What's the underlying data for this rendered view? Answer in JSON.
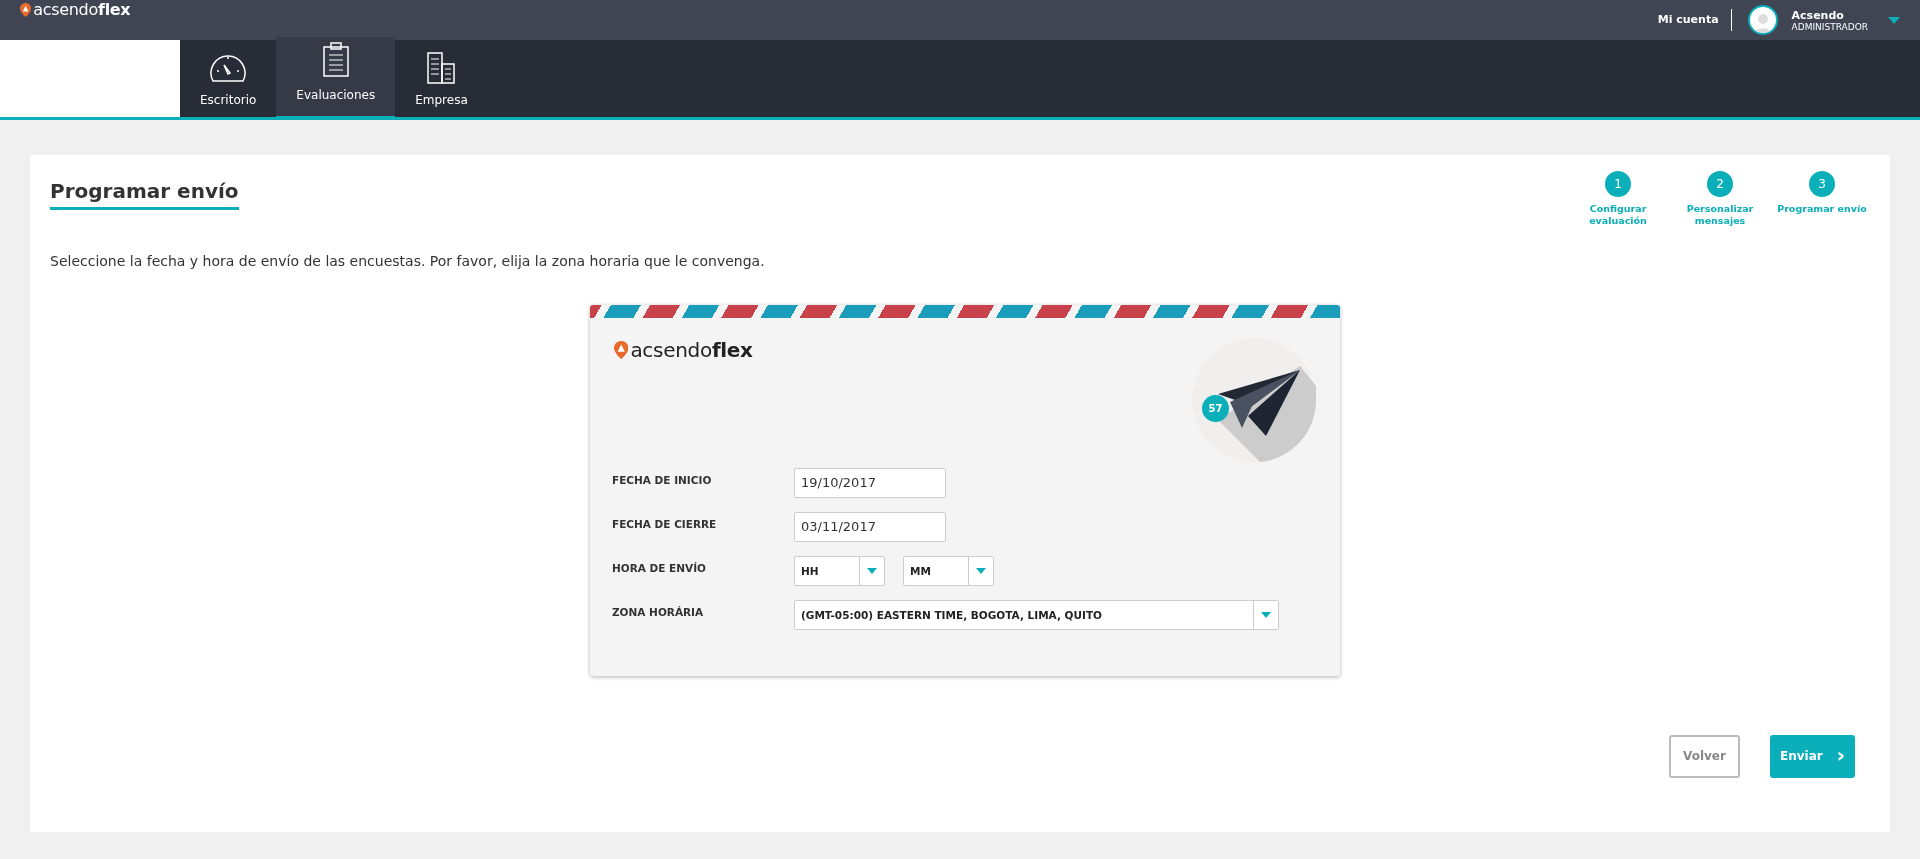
{
  "header": {
    "logo": "acsendo**flex**",
    "account_link": "Mi cuenta",
    "user": {
      "name": "Acsendo",
      "role": "ADMINISTRADOR"
    }
  },
  "nav_tabs": [
    {
      "label": "Escritorio",
      "kind": "gauge",
      "selected": false
    },
    {
      "label": "Evaluaciones",
      "kind": "clipboard",
      "selected": true
    },
    {
      "label": "Empresa",
      "kind": "building",
      "selected": false
    }
  ],
  "page": {
    "title": "Programar envío",
    "description": "Seleccione la fecha y hora de envío de las encuestas. Por favor, elija la zona horaria que le convenga."
  },
  "steps": [
    {
      "number": "1",
      "label": "Configurar evaluación"
    },
    {
      "number": "2",
      "label": "Personalizar mensajes"
    },
    {
      "number": "3",
      "label": "Programar envío"
    }
  ],
  "envelope": {
    "logo": "acsendo**flex**",
    "badge": "57",
    "fields": [
      {
        "kind": "input",
        "label": "FECHA DE INICIO",
        "values": [
          "19/10/2017"
        ]
      },
      {
        "kind": "input",
        "label": "FECHA DE CIERRE",
        "values": [
          "03/11/2017"
        ]
      },
      {
        "kind": "selects",
        "label": "HORA DE ENVÍO",
        "values": [
          "HH",
          "MM"
        ]
      },
      {
        "kind": "wide_select",
        "label": "ZONA HORÁRIA",
        "values": [
          "(GMT-05:00) EASTERN TIME, BOGOTA, LIMA, QUITO"
        ]
      }
    ]
  },
  "buttons": {
    "back": "Volver",
    "send": "Enviar",
    "send_arrow": "›"
  }
}
